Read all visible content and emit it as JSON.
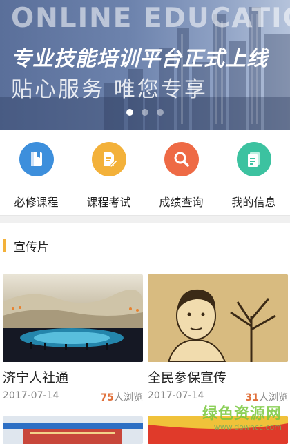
{
  "banner": {
    "en_title": "ONLINE EDUCATION",
    "headline": "专业技能培训平台正式上线",
    "tagline": "贴心服务 唯您专享",
    "slide_count": 3,
    "active_slide": 1
  },
  "menu": {
    "items": [
      {
        "label": "必修课程",
        "icon": "book-icon",
        "color": "#3d8fdc"
      },
      {
        "label": "课程考试",
        "icon": "exam-pencil-icon",
        "color": "#f3b13a"
      },
      {
        "label": "成绩查询",
        "icon": "search-icon",
        "color": "#ee6a45"
      },
      {
        "label": "我的信息",
        "icon": "document-icon",
        "color": "#3cc2a0"
      }
    ]
  },
  "section": {
    "title": "宣传片",
    "accent": "#f3b13a"
  },
  "videos": [
    {
      "title": "济宁人社通",
      "date": "2017-07-14",
      "views": "75",
      "views_suffix": "人浏览"
    },
    {
      "title": "全民参保宣传",
      "date": "2017-07-14",
      "views": "31",
      "views_suffix": "人浏览"
    }
  ],
  "watermark": {
    "line1": "绿色资源网",
    "line2": "www.downcc.com"
  }
}
